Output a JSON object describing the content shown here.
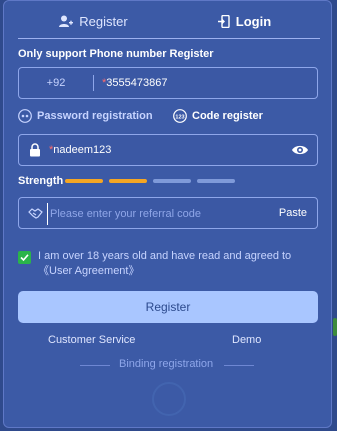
{
  "tabs": [
    {
      "label": "Register",
      "icon": "user-add-icon"
    },
    {
      "label": "Login",
      "icon": "login-door-icon"
    }
  ],
  "phone_section": {
    "label": "Only support Phone number Register",
    "country_code": "+92",
    "required_mark": "*",
    "value": "3555473867"
  },
  "modes": [
    {
      "label": "Password registration",
      "icon": "password-dots-icon"
    },
    {
      "label": "Code register",
      "icon": "code-123-icon"
    }
  ],
  "password": {
    "required_mark": "*",
    "value": "nadeem123",
    "icon": "lock-icon",
    "toggle_icon": "eye-icon"
  },
  "strength": {
    "label": "Strength",
    "level": 2,
    "max": 4,
    "active_color": "#f5a623",
    "inactive_color": "#7f9ad9"
  },
  "referral": {
    "placeholder": "Please enter your referral code",
    "paste_label": "Paste",
    "icon": "handshake-icon"
  },
  "agreement": {
    "checked": true,
    "text": "I am over 18 years old and have read and agreed to《User Agreement》"
  },
  "buttons": {
    "register": "Register"
  },
  "links": {
    "customer_service": "Customer Service",
    "demo": "Demo"
  },
  "binding": {
    "label": "Binding registration"
  },
  "colors": {
    "panel": "#3c5aa6",
    "accent_button": "#a9c6ff",
    "checkbox": "#2ab44a"
  }
}
